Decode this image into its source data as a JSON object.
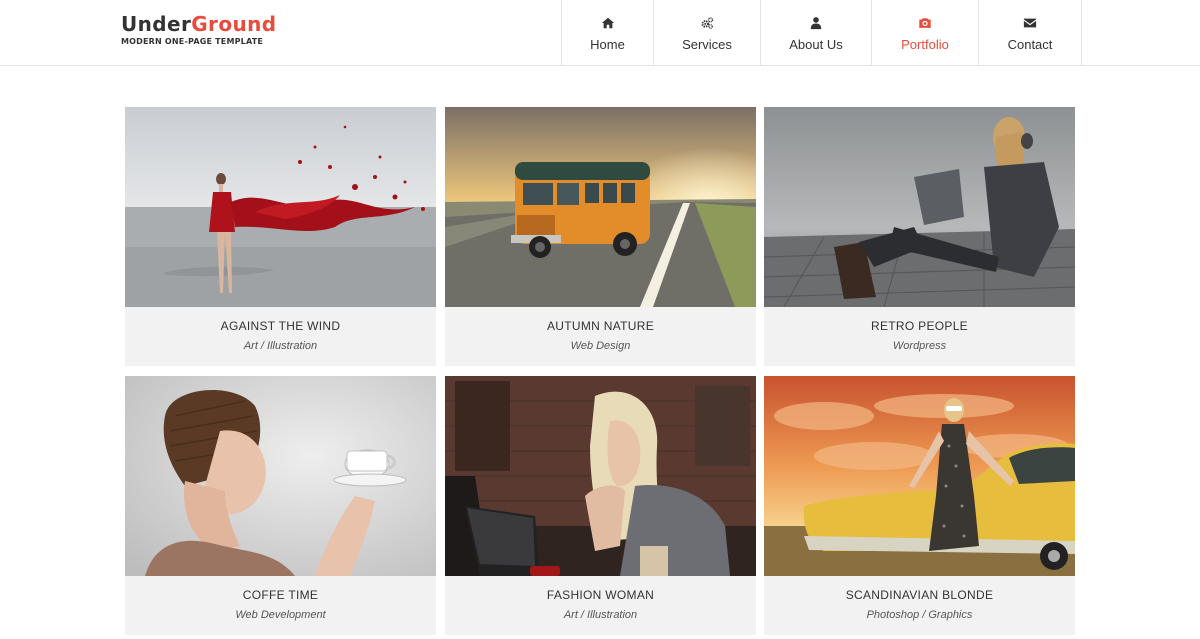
{
  "brand": {
    "name_part1": "Under",
    "name_part2": "Ground",
    "tagline": "MODERN ONE-PAGE TEMPLATE",
    "accent_color": "#e74c3c"
  },
  "nav": {
    "items": [
      {
        "label": "Home",
        "icon": "home-icon",
        "active": false
      },
      {
        "label": "Services",
        "icon": "cogs-icon",
        "active": false
      },
      {
        "label": "About Us",
        "icon": "user-icon",
        "active": false
      },
      {
        "label": "Portfolio",
        "icon": "camera-icon",
        "active": true
      },
      {
        "label": "Contact",
        "icon": "envelope-icon",
        "active": false
      }
    ]
  },
  "portfolio": {
    "items": [
      {
        "title": "AGAINST THE WIND",
        "category": "Art / Illustration"
      },
      {
        "title": "AUTUMN NATURE",
        "category": "Web Design"
      },
      {
        "title": "RETRO PEOPLE",
        "category": "Wordpress"
      },
      {
        "title": "COFFE TIME",
        "category": "Web Development"
      },
      {
        "title": "FASHION WOMAN",
        "category": "Art / Illustration"
      },
      {
        "title": "SCANDINAVIAN BLONDE",
        "category": "Photoshop / Graphics"
      }
    ]
  }
}
